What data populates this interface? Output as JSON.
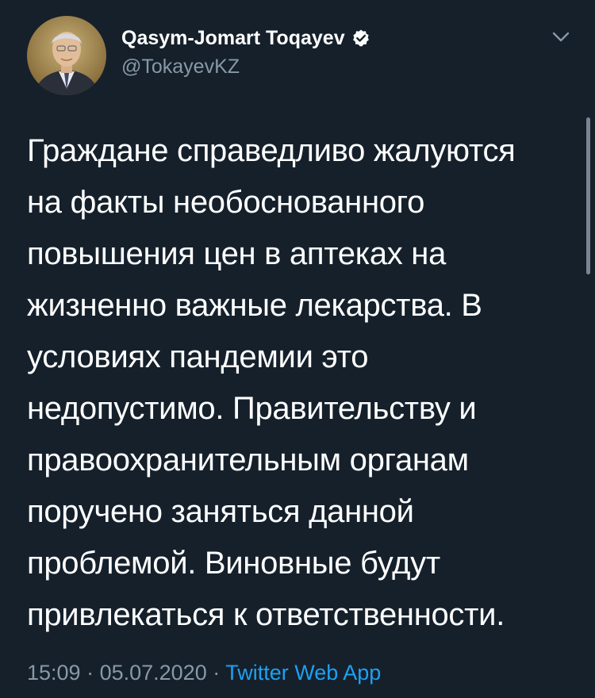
{
  "author": {
    "display_name": "Qasym-Jomart Toqayev",
    "handle": "@TokayevKZ",
    "verified": true
  },
  "tweet": {
    "text": "Граждане справедливо жалуются\nна факты необоснованного\nповышения цен в аптеках на\nжизненно важные лекарства. В\nусловиях пандемии это\nнедопустимо. Правительству и\nправоохранительным органам\nпоручено заняться данной\nпроблемой. Виновные будут\nпривлекаться к ответственности."
  },
  "meta": {
    "time": "15:09",
    "separator": " · ",
    "date": "05.07.2020",
    "source": "Twitter Web App"
  },
  "icons": {
    "verified": "verified-badge-icon",
    "menu": "chevron-down-icon"
  },
  "colors": {
    "background": "#15202b",
    "primary_text": "#ffffff",
    "secondary_text": "#8899a6",
    "link": "#1da1f2"
  }
}
